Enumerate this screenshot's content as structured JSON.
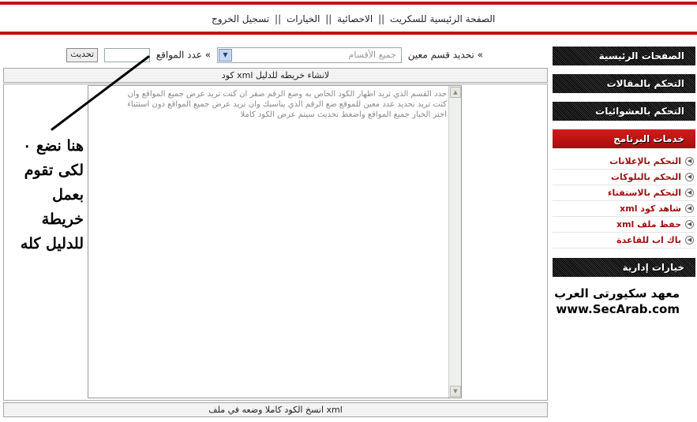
{
  "topnav": {
    "home": "الصفحة الرئيسية للسكريت",
    "stats": "الاحصائية",
    "options": "الخيارات",
    "logout": "تسجيل الخروج",
    "separator": "||"
  },
  "filters": {
    "section_label": "» تحديد قسم معين",
    "section_value": "جميع الأقسام",
    "count_label": "» عدد المواقع",
    "count_value": "",
    "refresh_button": "تحديث"
  },
  "main": {
    "top_bar": "كود xml لانشاء خريطه للدليل",
    "textarea_text": "حدد القسم الذي تريد اظهار الكود الخاص به وضع الرقم صفر ان كنت تريد عرض جميع المواقع وان\nكنت تريد تحديد عدد معين للموقع ضع الرقم الذي يناسبك وان تريد عرض جميع المواقع دون استثناء\nاختر الخيار جميع المواقع واضغط تحديث سيتم عرض الكود كاملا",
    "bottom_bar": "انسخ الكود كاملا وضعه في ملف xml"
  },
  "annotation": {
    "line1": "هنا نضع ٠",
    "line2": "لكى تقوم",
    "line3": "بعمل",
    "line4": "خريطة",
    "line5": "للدليل كله"
  },
  "sidebar": {
    "headers": [
      "الصفحات الرئيسية",
      "التحكم بالمقالات",
      "التحكم بالعشوائيات",
      "خدمات البرنامج",
      "خيارات إدارية"
    ],
    "services": [
      "التحكم بالإعلانات",
      "التحكم بالبلوكات",
      "التحكم بالاستفتاء",
      "شاهد كود xml",
      "حفظ ملف xml",
      "باك اب للقاعدة"
    ],
    "brand_name": "معهد سكيورتى العرب",
    "brand_url": "www.SecArab.com"
  },
  "colors": {
    "accent_red": "#c41212",
    "link_red": "#a01010"
  }
}
